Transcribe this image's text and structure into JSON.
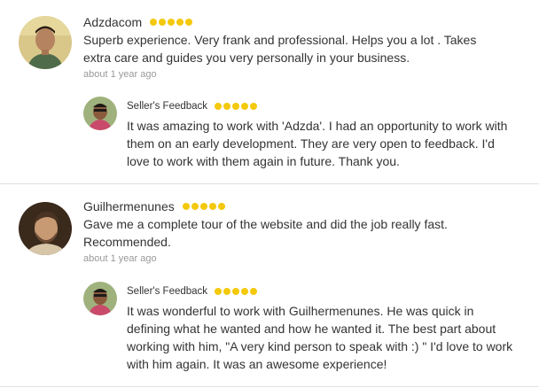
{
  "reviews": [
    {
      "name": "Adzdacom",
      "rating": 5,
      "text": "Superb experience. Very frank and professional. Helps you a lot . Takes extra care and guides you very personally in your business.",
      "time": "about 1 year ago",
      "feedback": {
        "title": "Seller's Feedback",
        "rating": 5,
        "text": "It was amazing to work with 'Adzda'. I had an opportunity to work with them on an early development. They are very open to feedback. I'd love to work with them again in future. Thank you."
      }
    },
    {
      "name": "Guilhermenunes",
      "rating": 5,
      "text": "Gave me a complete tour of the website and did the job really fast. Recommended.",
      "time": "about 1 year ago",
      "feedback": {
        "title": "Seller's Feedback",
        "rating": 5,
        "text": "It was wonderful to work with Guilhermenunes. He was quick in defining what he wanted and how he wanted it. The best part about working with him, \"A very kind person to speak with :) \" I'd love to work with him again. It was an awesome experience!"
      }
    }
  ],
  "colors": {
    "star": "#f4c90b",
    "text": "#333333",
    "muted": "#999999",
    "divider": "#e1e1e1"
  }
}
